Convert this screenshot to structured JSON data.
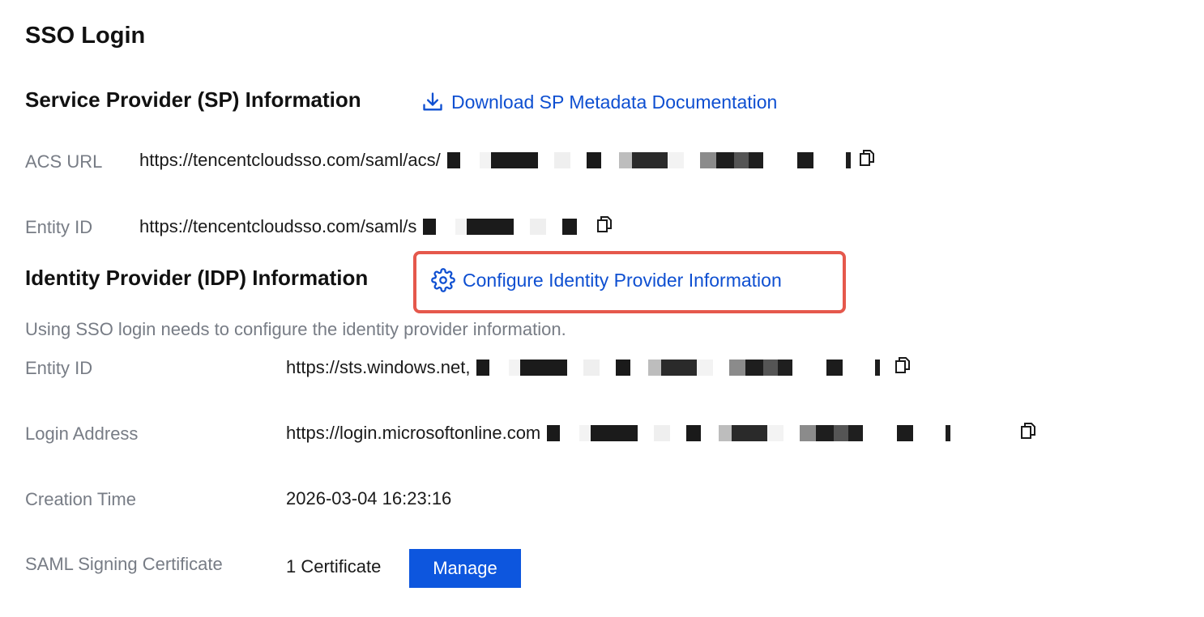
{
  "page": {
    "title": "SSO Login"
  },
  "sp_section": {
    "title": "Service Provider (SP) Information",
    "download_link": "Download SP Metadata Documentation",
    "fields": [
      {
        "label": "ACS URL",
        "value": "https://tencentcloudsso.com/saml/acs/"
      },
      {
        "label": "Entity ID",
        "value": "https://tencentcloudsso.com/saml/s"
      }
    ]
  },
  "idp_section": {
    "title": "Identity Provider (IDP) Information",
    "configure_link": "Configure Identity Provider Information",
    "hint": "Using SSO login needs to configure the identity provider information.",
    "fields": [
      {
        "label": "Entity ID",
        "value": "https://sts.windows.net,"
      },
      {
        "label": "Login Address",
        "value": "https://login.microsoftonline.com"
      },
      {
        "label": "Creation Time",
        "value": "2026-03-04 16:23:16"
      },
      {
        "label": "SAML Signing Certificate",
        "value": "1 Certificate"
      }
    ],
    "manage_button": "Manage"
  },
  "icons": {
    "download": "download-icon",
    "gear": "gear-icon",
    "copy": "copy-icon"
  },
  "colors": {
    "link": "#0e4fd1",
    "button": "#0d56de",
    "highlight_border": "#e5584c",
    "label": "#777c85"
  }
}
